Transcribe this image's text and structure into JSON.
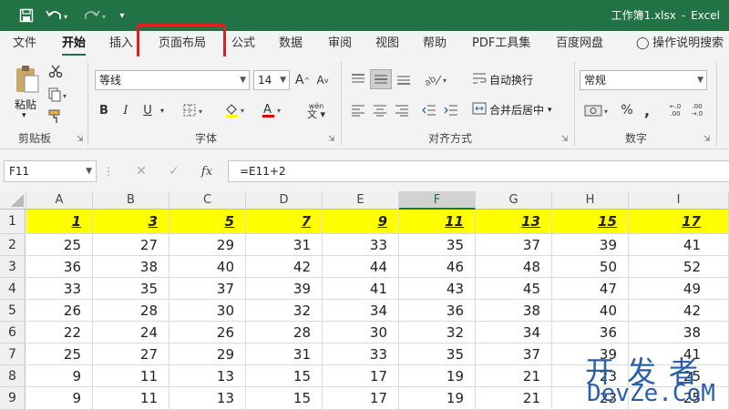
{
  "titlebar": {
    "doc_title": "工作簿1.xlsx",
    "separator": "-",
    "app_name": "Excel",
    "bg_color": "#217346"
  },
  "quick_access": [
    "save-icon",
    "undo-icon",
    "redo-icon",
    "customize-icon"
  ],
  "tabs": [
    {
      "label": "文件"
    },
    {
      "label": "开始",
      "active": true
    },
    {
      "label": "插入"
    },
    {
      "label": "页面布局",
      "highlighted": true
    },
    {
      "label": "公式"
    },
    {
      "label": "数据"
    },
    {
      "label": "审阅"
    },
    {
      "label": "视图"
    },
    {
      "label": "帮助"
    },
    {
      "label": "PDF工具集"
    },
    {
      "label": "百度网盘"
    },
    {
      "label": "操作说明搜索"
    }
  ],
  "ribbon": {
    "clipboard": {
      "paste_label": "粘贴",
      "group_label": "剪贴板"
    },
    "font": {
      "font_name": "等线",
      "font_size": "14",
      "group_label": "字体",
      "bold": "B",
      "italic": "I",
      "underline": "U",
      "phonetic": "wén"
    },
    "alignment": {
      "wrap_label": "自动换行",
      "merge_label": "合并后居中",
      "group_label": "对齐方式"
    },
    "number": {
      "format": "常规",
      "group_label": "数字",
      "percent": "%",
      "comma": ","
    }
  },
  "formula_bar": {
    "name_box": "F11",
    "formula": "=E11+2",
    "fx_label": "fx"
  },
  "sheet": {
    "columns": [
      "A",
      "B",
      "C",
      "D",
      "E",
      "F",
      "G",
      "H",
      "I"
    ],
    "selected_column": "F",
    "rows": [
      {
        "num": "1",
        "values": [
          "1",
          "3",
          "5",
          "7",
          "9",
          "11",
          "13",
          "15",
          "17"
        ]
      },
      {
        "num": "2",
        "values": [
          "25",
          "27",
          "29",
          "31",
          "33",
          "35",
          "37",
          "39",
          "41"
        ]
      },
      {
        "num": "3",
        "values": [
          "36",
          "38",
          "40",
          "42",
          "44",
          "46",
          "48",
          "50",
          "52"
        ]
      },
      {
        "num": "4",
        "values": [
          "33",
          "35",
          "37",
          "39",
          "41",
          "43",
          "45",
          "47",
          "49"
        ]
      },
      {
        "num": "5",
        "values": [
          "26",
          "28",
          "30",
          "32",
          "34",
          "36",
          "38",
          "40",
          "42"
        ]
      },
      {
        "num": "6",
        "values": [
          "22",
          "24",
          "26",
          "28",
          "30",
          "32",
          "34",
          "36",
          "38"
        ]
      },
      {
        "num": "7",
        "values": [
          "25",
          "27",
          "29",
          "31",
          "33",
          "35",
          "37",
          "39",
          "41"
        ]
      },
      {
        "num": "8",
        "values": [
          "9",
          "11",
          "13",
          "15",
          "17",
          "19",
          "21",
          "23",
          "25"
        ]
      },
      {
        "num": "9",
        "values": [
          "9",
          "11",
          "13",
          "15",
          "17",
          "19",
          "21",
          "23",
          "25"
        ]
      }
    ],
    "header_row_color": "#ffff00"
  },
  "watermark": {
    "cn": "开发者",
    "en": "DevZe.CoM"
  }
}
